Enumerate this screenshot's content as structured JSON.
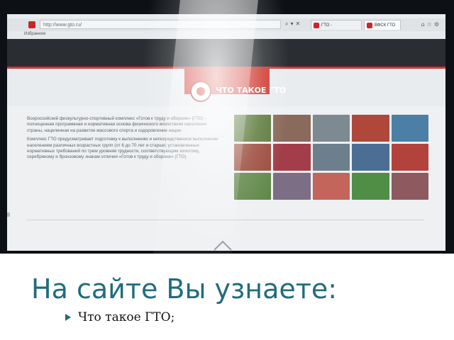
{
  "browser": {
    "url": "http://www.gto.ru/",
    "tabs": [
      "ГТО - Всероссийский...",
      "ВФСК ГТО"
    ],
    "favorites_label": "Избранное"
  },
  "site": {
    "section_title": "ЧТО ТАКОЕ ГТО",
    "paragraphs": [
      "Всероссийский физкультурно-спортивный комплекс «Готов к труду и обороне» (ГТО) – полноценная программная и нормативная основа физического воспитания населения страны, нацеленная на развитие массового спорта и оздоровление нации.",
      "Комплекс ГТО предусматривает подготовку к выполнению и непосредственное выполнение населением различных возрастных групп (от 6 до 70 лет и старше) установленных нормативных требований по трем уровням трудности, соответствующим золотому, серебряному и бронзовому знакам отличия «Готов к труду и обороне» (ГТО)."
    ],
    "photo_tiles": [
      {
        "name": "photo-athletes-outdoor",
        "color": "#5c7a3a"
      },
      {
        "name": "photo-crowd-event",
        "color": "#8a6a5a"
      },
      {
        "name": "photo-gym-exercise",
        "color": "#7e8a92"
      },
      {
        "name": "photo-running-track",
        "color": "#b0473b"
      },
      {
        "name": "photo-swimming",
        "color": "#4b7fa6"
      },
      {
        "name": "photo-sprinters",
        "color": "#9a4b3c"
      },
      {
        "name": "photo-stadium-crowd",
        "color": "#a23d49"
      },
      {
        "name": "photo-ceremony",
        "color": "#6d7f8c"
      },
      {
        "name": "photo-team-group",
        "color": "#4d6e93"
      },
      {
        "name": "photo-red-uniforms",
        "color": "#b2433c"
      },
      {
        "name": "photo-field-games",
        "color": "#61884b"
      },
      {
        "name": "photo-children",
        "color": "#7b6e85"
      },
      {
        "name": "photo-girl-portrait",
        "color": "#c3655b"
      },
      {
        "name": "photo-park-run",
        "color": "#508d45"
      },
      {
        "name": "photo-medal-winners",
        "color": "#8c5a5f"
      }
    ]
  },
  "slide": {
    "heading": "На сайте Вы узнаете:",
    "bullets": [
      "Что такое ГТО;"
    ]
  }
}
